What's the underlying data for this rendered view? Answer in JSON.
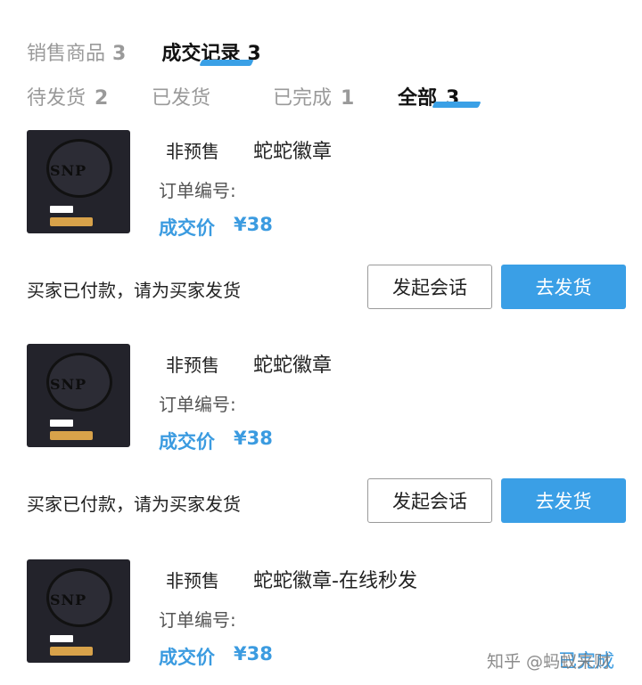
{
  "top_tabs": [
    {
      "label": "销售商品",
      "count": "3"
    },
    {
      "label": "成交记录",
      "count": "3"
    }
  ],
  "sub_tabs": [
    {
      "label": "待发货",
      "count": "2"
    },
    {
      "label": "已发货",
      "count": ""
    },
    {
      "label": "已完成",
      "count": "1"
    },
    {
      "label": "全部",
      "count": "3"
    }
  ],
  "accent_color": "#3a9fe6",
  "orders": [
    {
      "thumbnail_icon": "snake-badge-image",
      "presale": "非预售",
      "title": "蛇蛇徽章",
      "order_no_label": "订单编号:",
      "price_label": "成交价",
      "price": "¥38",
      "status": "买家已付款，请为买家发货",
      "chat_button": "发起会话",
      "ship_button": "去发货"
    },
    {
      "thumbnail_icon": "snake-badge-image",
      "presale": "非预售",
      "title": "蛇蛇徽章",
      "order_no_label": "订单编号:",
      "price_label": "成交价",
      "price": "¥38",
      "status": "买家已付款，请为买家发货",
      "chat_button": "发起会话",
      "ship_button": "去发货"
    },
    {
      "thumbnail_icon": "snake-badge-image",
      "presale": "非预售",
      "title": "蛇蛇徽章-在线秒发",
      "order_no_label": "订单编号:",
      "price_label": "成交价",
      "price": "¥38",
      "completed": "已完成"
    }
  ],
  "watermark": "知乎 @蚂蚁来财"
}
